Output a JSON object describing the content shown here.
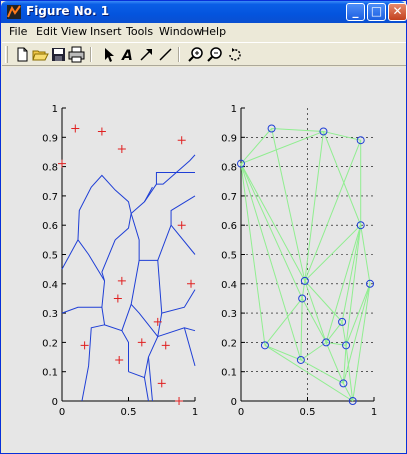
{
  "window": {
    "title": "Figure No. 1",
    "buttons": {
      "minimize": "_",
      "maximize": "□",
      "close": "✕"
    }
  },
  "menu": [
    "File",
    "Edit",
    "View",
    "Insert",
    "Tools",
    "Window",
    "Help"
  ],
  "toolbar": [
    {
      "name": "new-file-icon"
    },
    {
      "name": "open-folder-icon"
    },
    {
      "name": "save-icon"
    },
    {
      "name": "print-icon"
    },
    {
      "name": "select-arrow-icon"
    },
    {
      "name": "text-tool-icon"
    },
    {
      "name": "arrow-tool-icon"
    },
    {
      "name": "line-tool-icon"
    },
    {
      "name": "zoom-in-icon"
    },
    {
      "name": "zoom-out-icon"
    },
    {
      "name": "rotate-icon"
    }
  ],
  "colors": {
    "voronoi": "#1f3fd6",
    "marker_plus": "#e02020",
    "delaunay": "#90ee90",
    "circle": "#1f3fd6"
  },
  "chart_data": [
    {
      "type": "scatter",
      "title": "",
      "xlabel": "",
      "ylabel": "",
      "xlim": [
        0,
        1
      ],
      "ylim": [
        0,
        1
      ],
      "xticks": [
        "0",
        "0.5",
        "1"
      ],
      "yticks": [
        "0",
        "0.1",
        "0.2",
        "0.3",
        "0.4",
        "0.5",
        "0.6",
        "0.7",
        "0.8",
        "0.9",
        "1"
      ],
      "series": [
        {
          "marker": "+",
          "color": "#e02020",
          "points": [
            [
              0.0,
              0.81
            ],
            [
              0.1,
              0.93
            ],
            [
              0.3,
              0.92
            ],
            [
              0.45,
              0.86
            ],
            [
              0.9,
              0.89
            ],
            [
              0.9,
              0.6
            ],
            [
              0.97,
              0.4
            ],
            [
              0.45,
              0.41
            ],
            [
              0.42,
              0.35
            ],
            [
              0.72,
              0.27
            ],
            [
              0.6,
              0.2
            ],
            [
              0.78,
              0.19
            ],
            [
              0.17,
              0.19
            ],
            [
              0.43,
              0.14
            ],
            [
              0.75,
              0.06
            ],
            [
              0.88,
              0.0
            ]
          ]
        },
        {
          "type": "line",
          "color": "#1f3fd6",
          "segments": [
            [
              [
                0.0,
                0.45
              ],
              [
                0.12,
                0.55
              ],
              [
                0.13,
                0.65
              ],
              [
                0.22,
                0.73
              ],
              [
                0.3,
                0.77
              ],
              [
                0.4,
                0.72
              ],
              [
                0.5,
                0.68
              ],
              [
                0.52,
                0.64
              ],
              [
                0.62,
                0.68
              ],
              [
                0.71,
                0.74
              ],
              [
                0.76,
                0.74
              ],
              [
                0.96,
                0.82
              ],
              [
                1.0,
                0.84
              ]
            ],
            [
              [
                0.62,
                0.68
              ],
              [
                0.68,
                0.73
              ]
            ],
            [
              [
                0.71,
                0.74
              ],
              [
                0.71,
                0.78
              ],
              [
                1.0,
                0.78
              ]
            ],
            [
              [
                0.12,
                0.55
              ],
              [
                0.2,
                0.5
              ],
              [
                0.32,
                0.41
              ]
            ],
            [
              [
                0.52,
                0.64
              ],
              [
                0.5,
                0.59
              ],
              [
                0.4,
                0.55
              ]
            ],
            [
              [
                0.4,
                0.55
              ],
              [
                0.3,
                0.44
              ],
              [
                0.32,
                0.41
              ]
            ],
            [
              [
                0.52,
                0.64
              ],
              [
                0.58,
                0.55
              ],
              [
                0.58,
                0.48
              ],
              [
                0.72,
                0.48
              ],
              [
                0.82,
                0.6
              ],
              [
                0.82,
                0.65
              ],
              [
                1.0,
                0.7
              ]
            ],
            [
              [
                0.82,
                0.6
              ],
              [
                1.0,
                0.5
              ]
            ],
            [
              [
                0.72,
                0.48
              ],
              [
                0.75,
                0.3
              ],
              [
                0.92,
                0.32
              ],
              [
                1.0,
                0.38
              ]
            ],
            [
              [
                0.75,
                0.3
              ],
              [
                0.72,
                0.22
              ],
              [
                0.65,
                0.15
              ],
              [
                0.68,
                0.0
              ]
            ],
            [
              [
                0.72,
                0.22
              ],
              [
                0.92,
                0.25
              ],
              [
                1.0,
                0.24
              ]
            ],
            [
              [
                0.92,
                0.25
              ],
              [
                1.0,
                0.12
              ]
            ],
            [
              [
                0.32,
                0.41
              ],
              [
                0.3,
                0.32
              ],
              [
                0.32,
                0.26
              ],
              [
                0.45,
                0.24
              ],
              [
                0.5,
                0.2
              ],
              [
                0.5,
                0.1
              ]
            ],
            [
              [
                0.32,
                0.26
              ],
              [
                0.22,
                0.25
              ],
              [
                0.2,
                0.12
              ],
              [
                0.15,
                0.0
              ]
            ],
            [
              [
                0.5,
                0.1
              ],
              [
                0.62,
                0.08
              ],
              [
                0.65,
                0.15
              ]
            ],
            [
              [
                0.62,
                0.08
              ],
              [
                0.65,
                0.0
              ]
            ],
            [
              [
                0.58,
                0.48
              ],
              [
                0.52,
                0.33
              ],
              [
                0.45,
                0.24
              ]
            ],
            [
              [
                0.52,
                0.33
              ],
              [
                0.58,
                0.3
              ],
              [
                0.72,
                0.22
              ]
            ],
            [
              [
                0.3,
                0.32
              ],
              [
                0.12,
                0.32
              ],
              [
                0.0,
                0.3
              ]
            ]
          ]
        }
      ]
    },
    {
      "type": "scatter",
      "title": "",
      "xlabel": "",
      "ylabel": "",
      "xlim": [
        0,
        1
      ],
      "ylim": [
        0,
        1
      ],
      "xticks": [
        "0",
        "0.5",
        "1"
      ],
      "yticks": [
        "0",
        "0.1",
        "0.2",
        "0.3",
        "0.4",
        "0.5",
        "0.6",
        "0.7",
        "0.8",
        "0.9",
        "1"
      ],
      "grid": "dotted",
      "series": [
        {
          "marker": "o",
          "color": "#1f3fd6",
          "points": [
            [
              0.0,
              0.81
            ],
            [
              0.23,
              0.93
            ],
            [
              0.62,
              0.92
            ],
            [
              0.9,
              0.89
            ],
            [
              0.9,
              0.6
            ],
            [
              0.97,
              0.4
            ],
            [
              0.48,
              0.41
            ],
            [
              0.46,
              0.35
            ],
            [
              0.76,
              0.27
            ],
            [
              0.64,
              0.2
            ],
            [
              0.79,
              0.19
            ],
            [
              0.18,
              0.19
            ],
            [
              0.45,
              0.14
            ],
            [
              0.77,
              0.06
            ],
            [
              0.84,
              0.0
            ]
          ]
        },
        {
          "type": "line",
          "color": "#90ee90",
          "edges": [
            [
              0,
              1
            ],
            [
              1,
              2
            ],
            [
              2,
              3
            ],
            [
              3,
              4
            ],
            [
              4,
              5
            ],
            [
              0,
              2
            ],
            [
              0,
              6
            ],
            [
              0,
              7
            ],
            [
              0,
              11
            ],
            [
              0,
              12
            ],
            [
              1,
              6
            ],
            [
              2,
              6
            ],
            [
              2,
              4
            ],
            [
              3,
              6
            ],
            [
              4,
              6
            ],
            [
              4,
              8
            ],
            [
              4,
              9
            ],
            [
              4,
              10
            ],
            [
              5,
              10
            ],
            [
              5,
              13
            ],
            [
              5,
              14
            ],
            [
              6,
              7
            ],
            [
              6,
              8
            ],
            [
              6,
              9
            ],
            [
              7,
              11
            ],
            [
              7,
              12
            ],
            [
              7,
              9
            ],
            [
              8,
              9
            ],
            [
              8,
              10
            ],
            [
              9,
              10
            ],
            [
              9,
              12
            ],
            [
              9,
              13
            ],
            [
              10,
              13
            ],
            [
              11,
              12
            ],
            [
              12,
              13
            ],
            [
              13,
              14
            ],
            [
              11,
              14
            ],
            [
              10,
              14
            ]
          ]
        }
      ]
    }
  ]
}
